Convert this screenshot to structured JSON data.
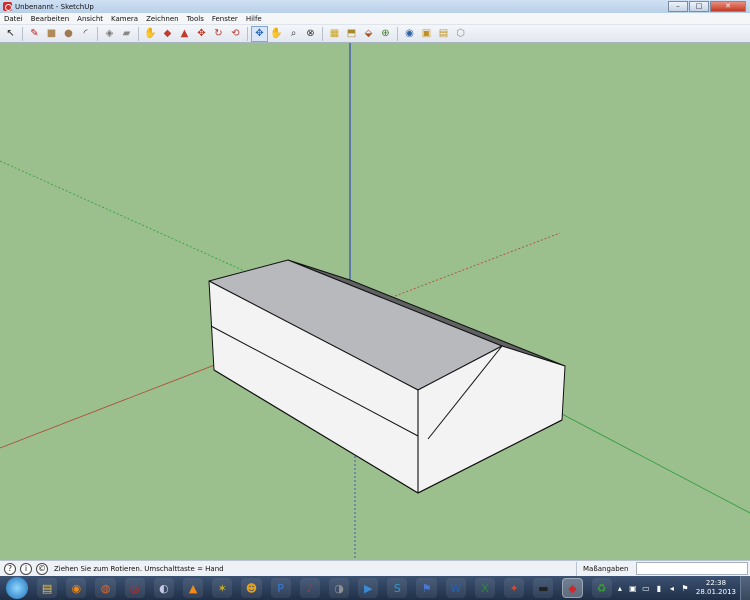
{
  "window": {
    "title": "Unbenannt - SketchUp",
    "minimize": "–",
    "maximize": "□",
    "close": "✕"
  },
  "menu": [
    "Datei",
    "Bearbeiten",
    "Ansicht",
    "Kamera",
    "Zeichnen",
    "Tools",
    "Fenster",
    "Hilfe"
  ],
  "toolbar": {
    "tools": [
      {
        "name": "select-tool-icon",
        "glyph": "↖",
        "color": "#222222"
      },
      {
        "name": "line-tool-icon",
        "glyph": "✎",
        "color": "#b52020"
      },
      {
        "name": "rectangle-tool-icon",
        "glyph": "■",
        "color": "#b08a5a"
      },
      {
        "name": "circle-tool-icon",
        "glyph": "●",
        "color": "#a07a52"
      },
      {
        "name": "arc-tool-icon",
        "glyph": "◜",
        "color": "#333333"
      },
      {
        "name": "make-component-icon",
        "glyph": "◈",
        "color": "#777777"
      },
      {
        "name": "eraser-tool-icon",
        "glyph": "▰",
        "color": "#888888"
      },
      {
        "name": "tape-measure-icon",
        "glyph": "✋",
        "color": "#b98a2c"
      },
      {
        "name": "paint-bucket-icon",
        "glyph": "◆",
        "color": "#c63a2a"
      },
      {
        "name": "push-pull-icon",
        "glyph": "▲",
        "color": "#c0392b"
      },
      {
        "name": "move-tool-icon",
        "glyph": "✥",
        "color": "#c0392b"
      },
      {
        "name": "rotate-tool-icon",
        "glyph": "↻",
        "color": "#c0392b"
      },
      {
        "name": "offset-tool-icon",
        "glyph": "⟲",
        "color": "#c0392b"
      },
      {
        "name": "orbit-tool-icon",
        "glyph": "✥",
        "color": "#2a64b8"
      },
      {
        "name": "pan-tool-icon",
        "glyph": "✋",
        "color": "#444444"
      },
      {
        "name": "zoom-tool-icon",
        "glyph": "⌕",
        "color": "#333333"
      },
      {
        "name": "zoom-extents-icon",
        "glyph": "⊗",
        "color": "#333333"
      },
      {
        "name": "get-models-icon",
        "glyph": "▦",
        "color": "#c9a227"
      },
      {
        "name": "share-model-icon",
        "glyph": "⬒",
        "color": "#a8892c"
      },
      {
        "name": "get-photo-texture-icon",
        "glyph": "⬙",
        "color": "#a0522d"
      },
      {
        "name": "add-location-icon",
        "glyph": "⊕",
        "color": "#3b7a2a"
      },
      {
        "name": "toggle-terrain-icon",
        "glyph": "◉",
        "color": "#2f5fa5"
      },
      {
        "name": "extension-warehouse-icon",
        "glyph": "▣",
        "color": "#c09020"
      },
      {
        "name": "send-to-layout-icon",
        "glyph": "▤",
        "color": "#c09020"
      },
      {
        "name": "preview-google-earth-icon",
        "glyph": "⬡",
        "color": "#888888"
      }
    ]
  },
  "status": {
    "help_icon": "?",
    "info_icon": "i",
    "credits_icon": "©",
    "message": "Ziehen Sie zum Rotieren.  Umschalttaste = Hand",
    "measurement_label": "Maßangaben",
    "measurement_value": ""
  },
  "taskbar": {
    "apps": [
      {
        "name": "explorer-icon",
        "glyph": "▤",
        "color": "#e8c15a"
      },
      {
        "name": "media-player-icon",
        "glyph": "◉",
        "color": "#e88a1c"
      },
      {
        "name": "firefox-icon",
        "glyph": "◍",
        "color": "#e0672a"
      },
      {
        "name": "opera-icon",
        "glyph": "◎",
        "color": "#cc2a2a"
      },
      {
        "name": "dvd-player-icon",
        "glyph": "◐",
        "color": "#c7c7e6"
      },
      {
        "name": "vlc-icon",
        "glyph": "▲",
        "color": "#f08a1a"
      },
      {
        "name": "scanner-icon",
        "glyph": "✶",
        "color": "#d2b020"
      },
      {
        "name": "chat-icon",
        "glyph": "☻",
        "color": "#e2a020"
      },
      {
        "name": "power-dvd-icon",
        "glyph": "P",
        "color": "#3a7bd5"
      },
      {
        "name": "music-icon",
        "glyph": "♪",
        "color": "#cc2a2a"
      },
      {
        "name": "disc-burner-icon",
        "glyph": "◑",
        "color": "#909090"
      },
      {
        "name": "movie-maker-icon",
        "glyph": "▶",
        "color": "#3a8ad5"
      },
      {
        "name": "skype-icon",
        "glyph": "S",
        "color": "#2a9ad5"
      },
      {
        "name": "media-center-icon",
        "glyph": "⚑",
        "color": "#4a7ad5"
      },
      {
        "name": "word-icon",
        "glyph": "W",
        "color": "#2b5fb4"
      },
      {
        "name": "excel-icon",
        "glyph": "X",
        "color": "#2f8a3a"
      },
      {
        "name": "fox-app-icon",
        "glyph": "✦",
        "color": "#d24a2a"
      },
      {
        "name": "command-prompt-icon",
        "glyph": "▬",
        "color": "#222222"
      },
      {
        "name": "sketchup-taskbar-icon",
        "glyph": "◆",
        "color": "#cc2a2a"
      },
      {
        "name": "recycle-app-icon",
        "glyph": "♻",
        "color": "#3aa03a"
      }
    ],
    "tray": [
      {
        "name": "show-hidden-icons-icon",
        "glyph": "▴"
      },
      {
        "name": "security-tray-icon",
        "glyph": "▣"
      },
      {
        "name": "device-tray-icon",
        "glyph": "▭"
      },
      {
        "name": "network-tray-icon",
        "glyph": "▮"
      },
      {
        "name": "volume-tray-icon",
        "glyph": "◂"
      },
      {
        "name": "flag-tray-icon",
        "glyph": "⚑"
      }
    ],
    "time": "22:38",
    "date": "28.01.2013"
  },
  "colors": {
    "viewport_background": "#9bc08e",
    "axis_red": "#b0432e",
    "axis_green": "#2f9a3a",
    "axis_blue": "#2a3fbd",
    "face_light": "#f3f3f3",
    "face_roof": "#b8b9bc",
    "face_shadow": "#5f6163",
    "edge": "#111111"
  }
}
